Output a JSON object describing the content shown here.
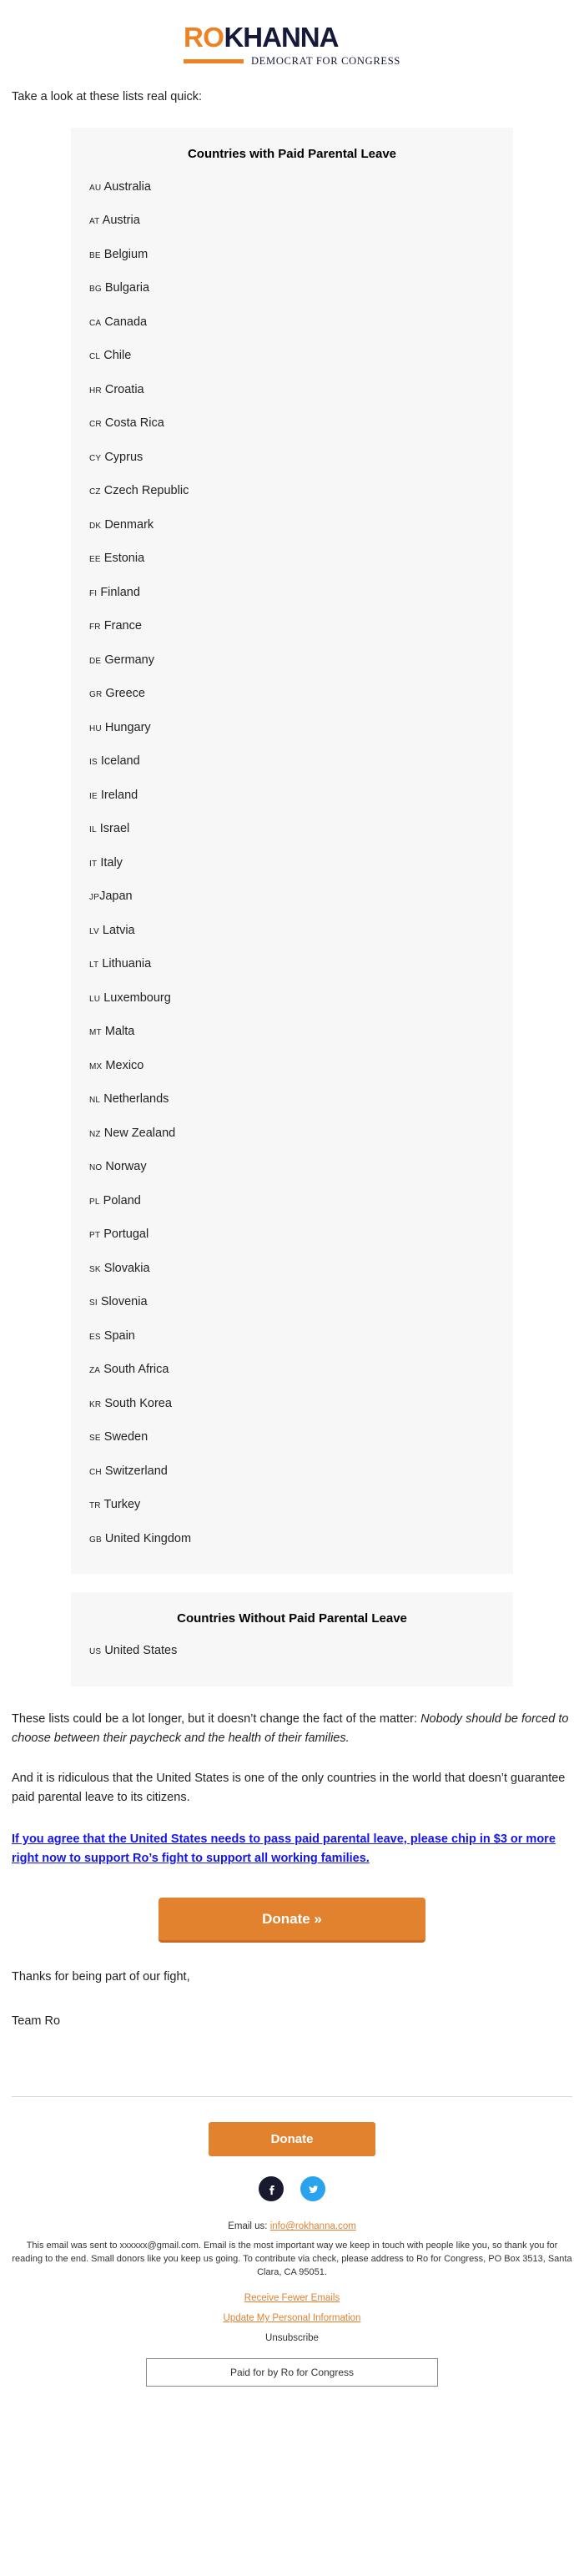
{
  "brand": {
    "logo_primary": "RO",
    "logo_secondary": "KHANNA",
    "tagline": "DEMOCRAT FOR CONGRESS",
    "accent_color": "#ee8124",
    "navy_color": "#17193a"
  },
  "intro": "Take a look at these lists real quick:",
  "panel_with": {
    "title": "Countries with Paid Parental Leave",
    "countries": [
      {
        "code": "AU",
        "name": "Australia"
      },
      {
        "code": "AT",
        "name": "Austria"
      },
      {
        "code": "BE",
        "name": "Belgium"
      },
      {
        "code": "BG",
        "name": "Bulgaria"
      },
      {
        "code": "CA",
        "name": "Canada"
      },
      {
        "code": "CL",
        "name": "Chile"
      },
      {
        "code": "HR",
        "name": "Croatia"
      },
      {
        "code": "CR",
        "name": "Costa Rica"
      },
      {
        "code": "CY",
        "name": "Cyprus"
      },
      {
        "code": "CZ",
        "name": "Czech Republic"
      },
      {
        "code": "DK",
        "name": "Denmark"
      },
      {
        "code": "EE",
        "name": "Estonia"
      },
      {
        "code": "FI",
        "name": "Finland"
      },
      {
        "code": "FR",
        "name": "France"
      },
      {
        "code": "DE",
        "name": "Germany"
      },
      {
        "code": "GR",
        "name": "Greece"
      },
      {
        "code": "HU",
        "name": "Hungary"
      },
      {
        "code": "IS",
        "name": "Iceland"
      },
      {
        "code": "IE",
        "name": "Ireland"
      },
      {
        "code": "IL",
        "name": "Israel"
      },
      {
        "code": "IT",
        "name": "Italy"
      },
      {
        "code": "JP",
        "name": "Japan",
        "nospace": true
      },
      {
        "code": "LV",
        "name": "Latvia"
      },
      {
        "code": "LT",
        "name": "Lithuania"
      },
      {
        "code": "LU",
        "name": "Luxembourg"
      },
      {
        "code": "MT",
        "name": "Malta"
      },
      {
        "code": "MX",
        "name": "Mexico"
      },
      {
        "code": "NL",
        "name": "Netherlands"
      },
      {
        "code": "NZ",
        "name": "New Zealand"
      },
      {
        "code": "NO",
        "name": "Norway"
      },
      {
        "code": "PL",
        "name": "Poland"
      },
      {
        "code": "PT",
        "name": "Portugal"
      },
      {
        "code": "SK",
        "name": "Slovakia"
      },
      {
        "code": "SI",
        "name": "Slovenia"
      },
      {
        "code": "ES",
        "name": "Spain"
      },
      {
        "code": "ZA",
        "name": "South Africa"
      },
      {
        "code": "KR",
        "name": "South Korea"
      },
      {
        "code": "SE",
        "name": "Sweden"
      },
      {
        "code": "CH",
        "name": "Switzerland"
      },
      {
        "code": "TR",
        "name": "Turkey"
      },
      {
        "code": "GB",
        "name": "United Kingdom"
      }
    ]
  },
  "panel_without": {
    "title": "Countries Without Paid Parental Leave",
    "countries": [
      {
        "code": "US",
        "name": "United States"
      }
    ]
  },
  "body": {
    "para1_plain": "These lists could be a lot longer, but it doesn’t change the fact of the matter: ",
    "para1_italic": "Nobody should be forced to choose between their paycheck and the health of their families.",
    "para2": "And it is ridiculous that the United States is one of the only countries in the world that doesn’t guarantee paid parental leave to its citizens.",
    "cta_link": "If you agree that the United States needs to pass paid parental leave, please chip in $3 or more right now to support Ro’s fight to support all working families.",
    "donate_label": "Donate »",
    "signoff_1": "Thanks for being part of our fight,",
    "signoff_2": "Team Ro"
  },
  "footer": {
    "donate_label": "Donate",
    "social_facebook": "facebook-icon",
    "social_twitter": "twitter-icon",
    "email_prefix": "Email us: ",
    "email_address": "info@rokhanna.com",
    "disclaimer": "This email was sent to xxxxxx@gmail.com. Email is the most important way we keep in touch with people like you, so thank you for reading to the end. Small donors like you keep us going. To contribute via check, please address to Ro for Congress, PO Box 3513, Santa Clara, CA 95051.",
    "link_fewer_emails": "Receive Fewer Emails",
    "link_update_info": "Update My Personal Information",
    "link_unsubscribe": "Unsubscribe",
    "paid_for_by": "Paid for by Ro for Congress"
  }
}
